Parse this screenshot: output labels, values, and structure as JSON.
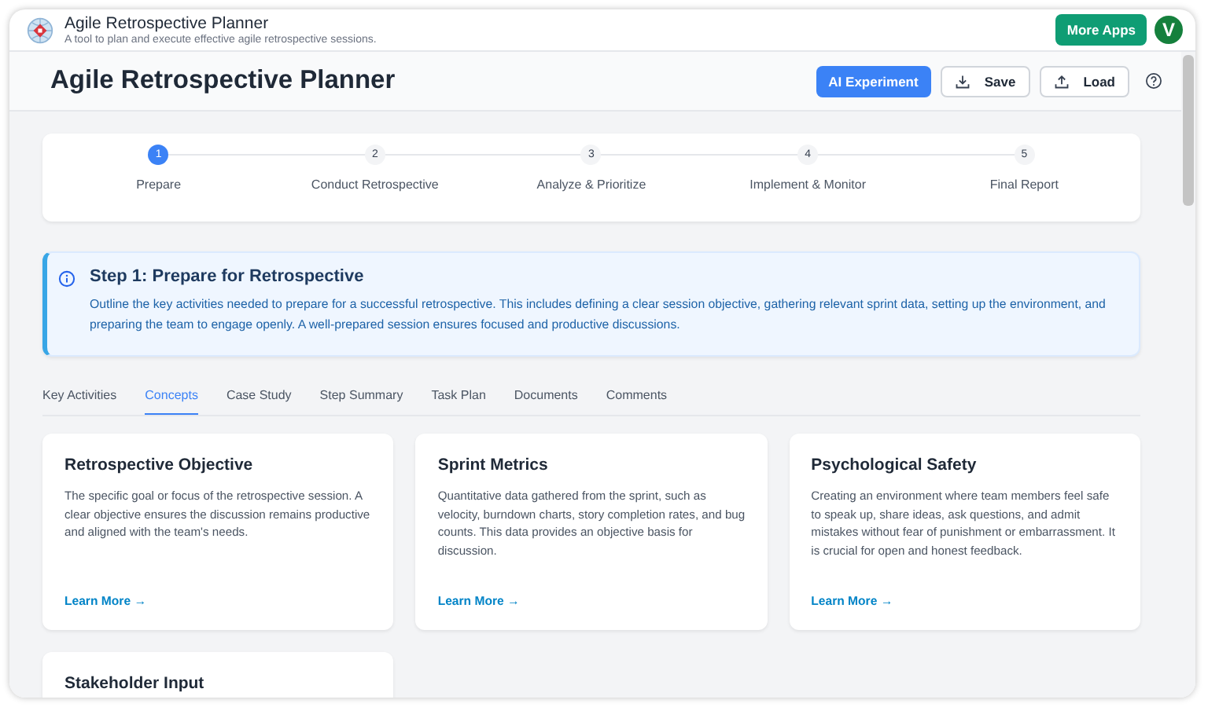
{
  "app_bar": {
    "title": "Agile Retrospective Planner",
    "subtitle": "A tool to plan and execute effective agile retrospective sessions.",
    "more_apps": "More Apps",
    "avatar": "V"
  },
  "header": {
    "title": "Agile Retrospective Planner",
    "buttons": [
      {
        "kind": "primary",
        "label": "AI Experiment"
      },
      {
        "kind": "download",
        "label": "Save"
      },
      {
        "kind": "upload",
        "label": "Load"
      },
      {
        "kind": "help"
      }
    ]
  },
  "steps": [
    {
      "number": "1",
      "label": "Prepare",
      "selected": true
    },
    {
      "number": "2",
      "label": "Conduct Retrospective",
      "selected": false
    },
    {
      "number": "3",
      "label": "Analyze & Prioritize",
      "selected": false
    },
    {
      "number": "4",
      "label": "Implement & Monitor",
      "selected": false
    },
    {
      "number": "5",
      "label": "Final Report",
      "selected": false
    }
  ],
  "info": {
    "title": "Step 1: Prepare for Retrospective",
    "text": "Outline the key activities needed to prepare for a successful retrospective. This includes defining a clear session objective, gathering relevant sprint data, setting up the environment, and preparing the team to engage openly. A well-prepared session ensures focused and productive discussions."
  },
  "tabs": [
    {
      "label": "Key Activities",
      "selected": false
    },
    {
      "label": "Concepts",
      "selected": true
    },
    {
      "label": "Case Study",
      "selected": false
    },
    {
      "label": "Step Summary",
      "selected": false
    },
    {
      "label": "Task Plan",
      "selected": false
    },
    {
      "label": "Documents",
      "selected": false
    },
    {
      "label": "Comments",
      "selected": false
    }
  ],
  "cards": [
    {
      "title": "Retrospective Objective",
      "text": "The specific goal or focus of the retrospective session. A clear objective ensures the discussion remains productive and aligned with the team's needs.",
      "link": "Learn More →"
    },
    {
      "title": "Sprint Metrics",
      "text": "Quantitative data gathered from the sprint, such as velocity, burndown charts, story completion rates, and bug counts. This data provides an objective basis for discussion.",
      "link": "Learn More →"
    },
    {
      "title": "Psychological Safety",
      "text": "Creating an environment where team members feel safe to speak up, share ideas, ask questions, and admit mistakes without fear of punishment or embarrassment. It is crucial for open and honest feedback.",
      "link": "Learn More →"
    },
    {
      "title": "Stakeholder Input"
    }
  ]
}
